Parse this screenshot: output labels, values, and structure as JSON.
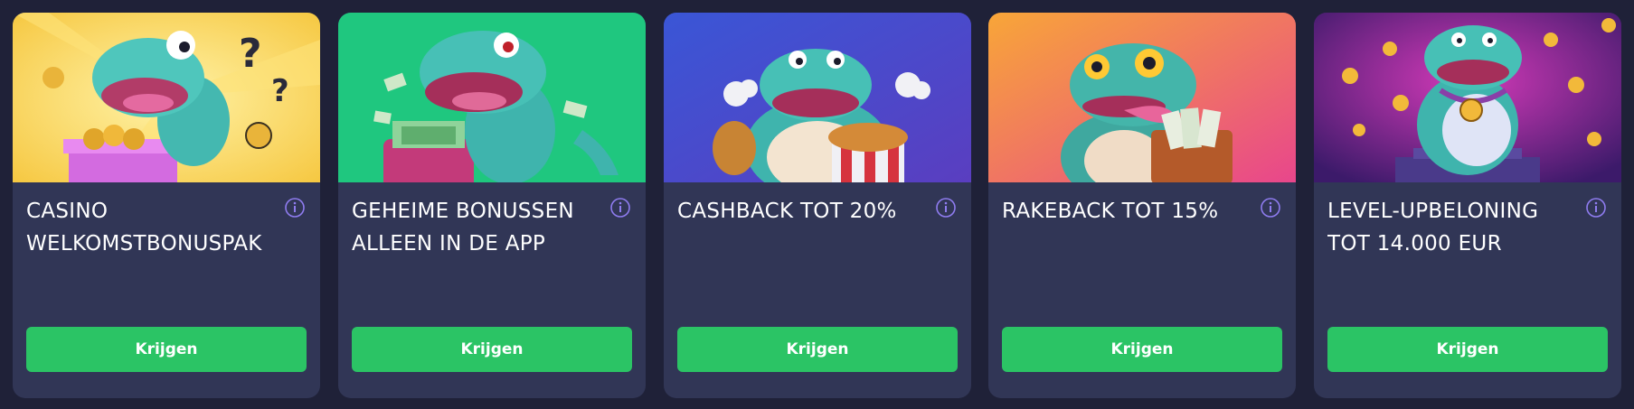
{
  "colors": {
    "page_background": "#1f2138",
    "card_background": "#313656",
    "button": "#2bc465",
    "info_icon": "#8f7cf0"
  },
  "cards": [
    {
      "illustration": "dinosaur-with-treasure-chest",
      "title": "CASINO\nWELKOMSTBONUSPAK",
      "button_label": "Krijgen",
      "info_icon": "info-icon"
    },
    {
      "illustration": "dinosaur-with-wallet-money",
      "title": "GEHEIME BONUSSEN\nALLEEN IN DE APP",
      "button_label": "Krijgen",
      "info_icon": "info-icon"
    },
    {
      "illustration": "dinosaur-with-fried-chicken",
      "title": "CASHBACK TOT 20%",
      "button_label": "Krijgen",
      "info_icon": "info-icon"
    },
    {
      "illustration": "dinosaur-with-cash-bag",
      "title": "RAKEBACK TOT 15%",
      "button_label": "Krijgen",
      "info_icon": "info-icon"
    },
    {
      "illustration": "dinosaur-with-gold-medal",
      "title": "LEVEL-UPBELONING\nTOT 14.000 EUR",
      "button_label": "Krijgen",
      "info_icon": "info-icon"
    }
  ]
}
